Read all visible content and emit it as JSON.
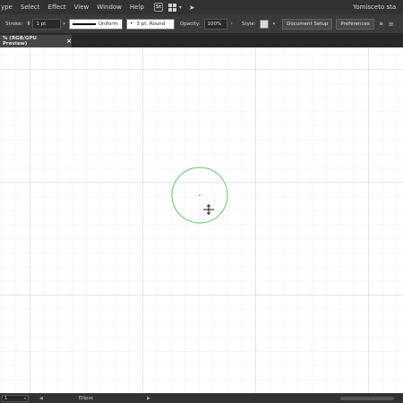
{
  "menu": {
    "items": [
      "ype",
      "Select",
      "Effect",
      "View",
      "Window",
      "Help"
    ],
    "st_badge": "St",
    "workspace_label": "Yomisceto sta"
  },
  "control_bar": {
    "stroke_label": "Stroke:",
    "stroke_weight": "1 pt",
    "profile_label": "Uniform",
    "brush_label": "3 pt. Round",
    "opacity_label": "Opacity:",
    "opacity_value": "100%",
    "style_label": "Style:",
    "document_setup": "Document Setup",
    "preferences": "Preferences"
  },
  "document_tab": {
    "title": "% (RGB/GPU Preview)",
    "close_glyph": "×"
  },
  "canvas": {
    "ellipse_stroke_color": "#5fc36b",
    "cursor_icon": "crosshair-move-icon"
  },
  "status_bar": {
    "zoom_value": "1",
    "tool_name": "Ellipse"
  },
  "colors": {
    "app_bg": "#323232",
    "canvas_bg": "#ffffff",
    "accent_green": "#5fc36b"
  }
}
